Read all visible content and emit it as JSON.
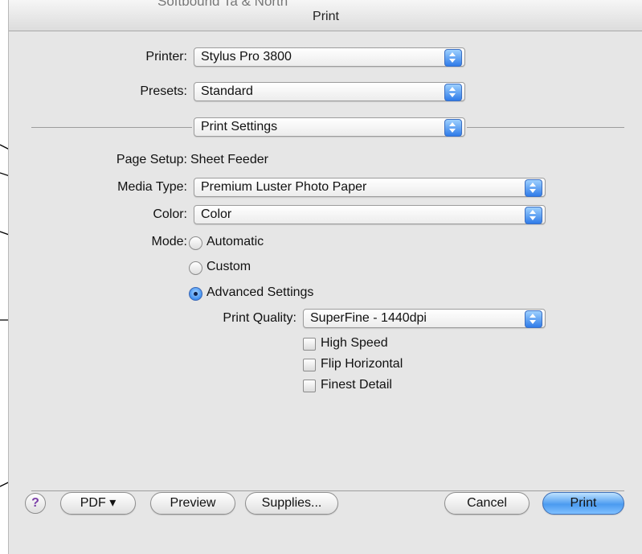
{
  "window": {
    "title": "Print",
    "ghost_title": "Softbound Ta & North"
  },
  "printer": {
    "label": "Printer:",
    "value": "Stylus Pro 3800"
  },
  "presets": {
    "label": "Presets:",
    "value": "Standard"
  },
  "pane": {
    "value": "Print Settings"
  },
  "page_setup": {
    "label": "Page Setup:",
    "value": "Sheet Feeder"
  },
  "media_type": {
    "label": "Media Type:",
    "value": "Premium Luster Photo Paper"
  },
  "color": {
    "label": "Color:",
    "value": "Color"
  },
  "mode": {
    "label": "Mode:",
    "options": [
      "Automatic",
      "Custom",
      "Advanced Settings"
    ],
    "selected": "Advanced Settings"
  },
  "print_quality": {
    "label": "Print Quality:",
    "value": "SuperFine - 1440dpi"
  },
  "checkboxes": [
    "High Speed",
    "Flip Horizontal",
    "Finest Detail"
  ],
  "buttons": {
    "help": "?",
    "pdf": "PDF ▾",
    "preview": "Preview",
    "supplies": "Supplies...",
    "cancel": "Cancel",
    "print": "Print"
  },
  "colors": {
    "accent_blue": "#2f7be8",
    "dialog_bg": "#e6e6e6",
    "help_purple": "#7b3fa8"
  }
}
